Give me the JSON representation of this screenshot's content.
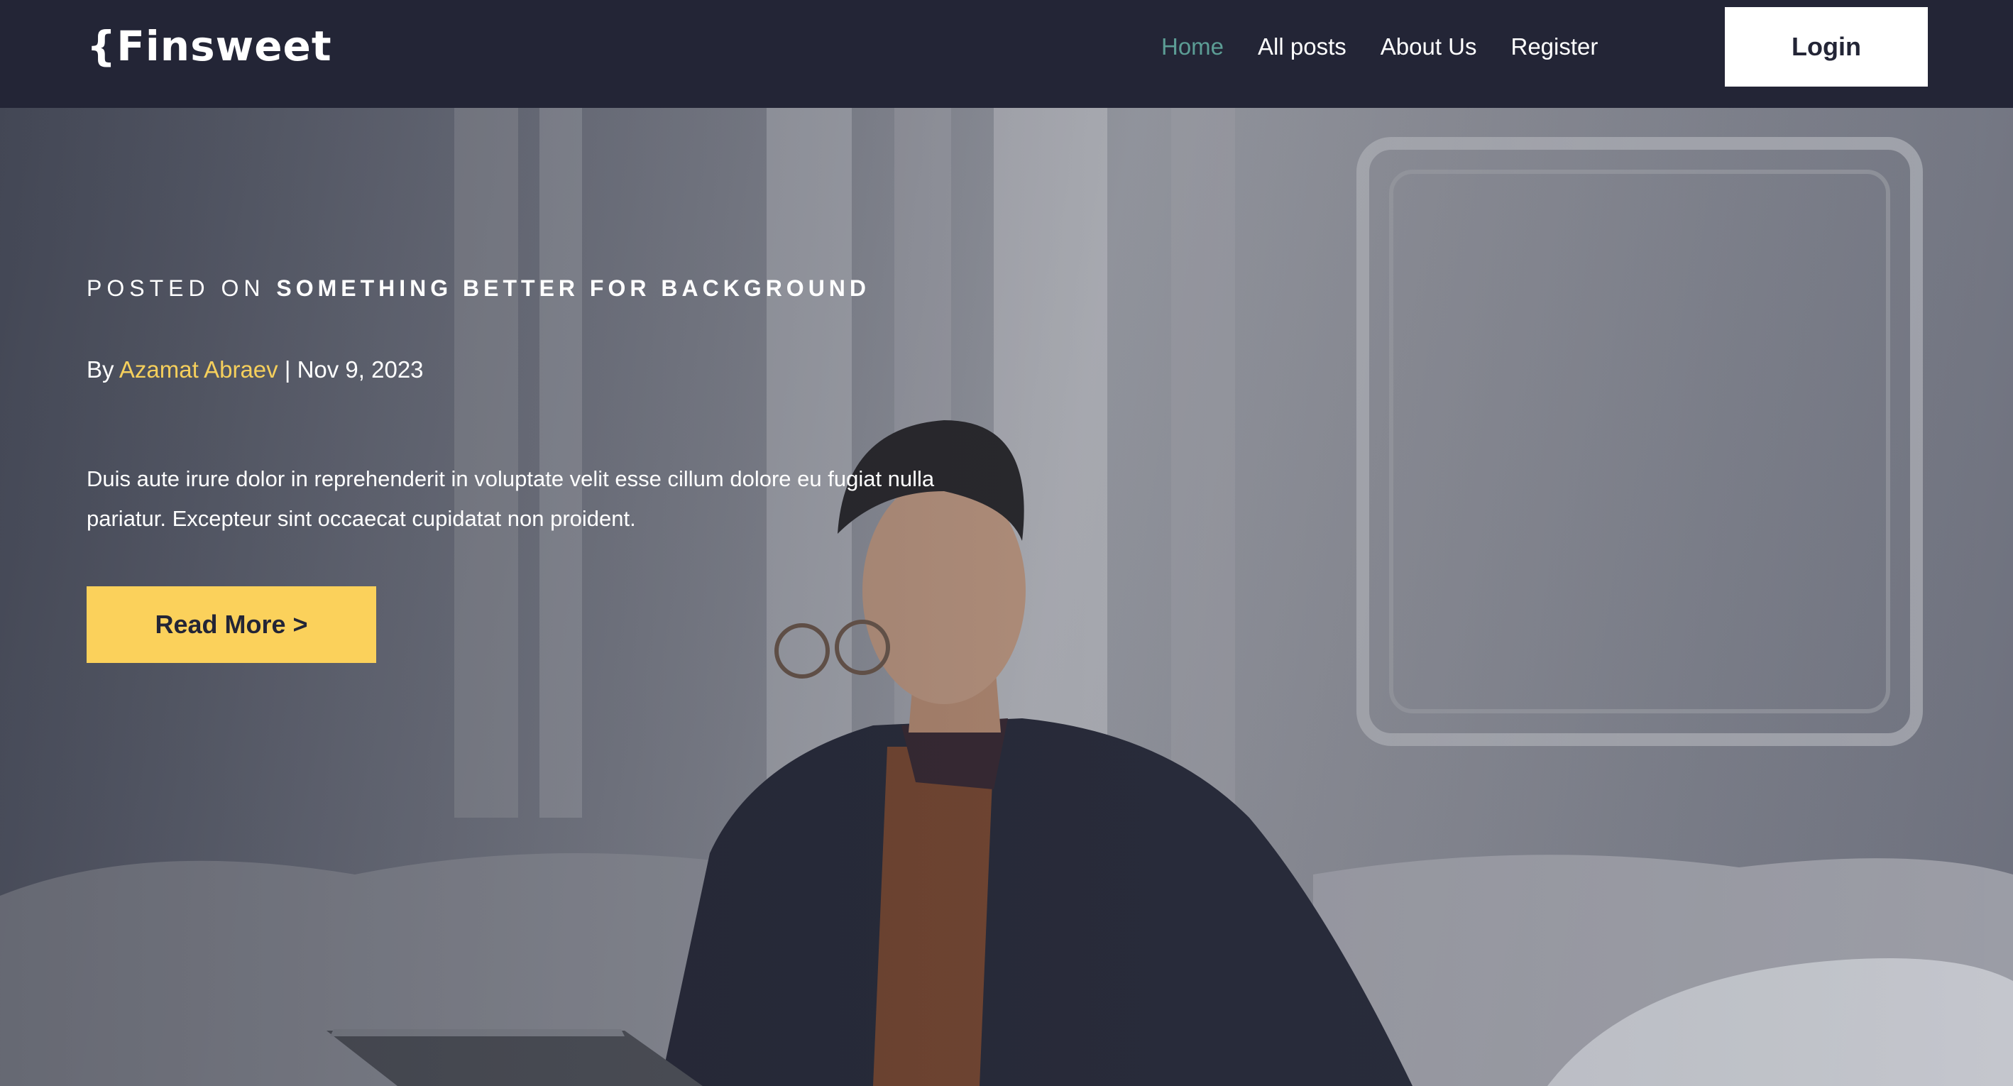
{
  "brand": {
    "logo_text": "{Finsweet"
  },
  "nav": {
    "items": [
      {
        "label": "Home",
        "active": true
      },
      {
        "label": "All posts",
        "active": false
      },
      {
        "label": "About Us",
        "active": false
      },
      {
        "label": "Register",
        "active": false
      }
    ],
    "login_label": "Login"
  },
  "hero": {
    "posted_on_prefix": "POSTED ON",
    "category": "SOMETHING BETTER FOR BACKGROUND",
    "by_label": "By",
    "author": "Azamat Abraev",
    "separator": "|",
    "date": "Nov 9, 2023",
    "excerpt": "Duis aute irure dolor in reprehenderit in voluptate velit esse cillum dolore eu fugiat nulla pariatur. Excepteur sint occaecat cupidatat non proident.",
    "read_more_label": "Read More >"
  },
  "colors": {
    "navbar_bg": "#232536",
    "accent_yellow": "#FBD15B",
    "active_nav": "#5C9D95",
    "author_color": "#F5CF5C"
  }
}
